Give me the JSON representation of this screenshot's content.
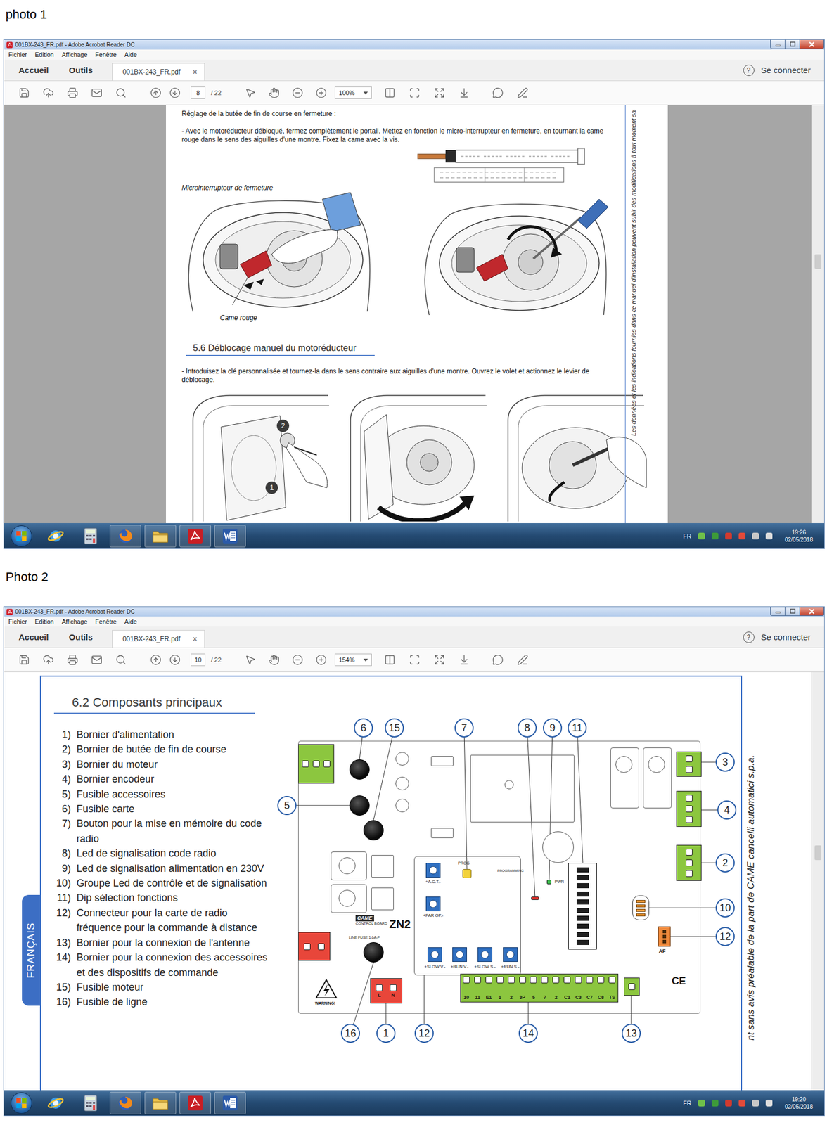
{
  "photos": [
    {
      "label": "photo 1",
      "window": {
        "title": "001BX-243_FR.pdf - Adobe Acrobat Reader DC",
        "menu": [
          "Fichier",
          "Edition",
          "Affichage",
          "Fenêtre",
          "Aide"
        ],
        "nav": [
          {
            "label": "Accueil",
            "selected": false
          },
          {
            "label": "Outils",
            "selected": false
          }
        ],
        "document_tab": {
          "label": "001BX-243_FR.pdf",
          "close": "×",
          "selected": true
        },
        "help": "?",
        "sign_in": "Se connecter",
        "toolbar": {
          "page": "8",
          "page_count": "/ 22",
          "zoom": "100%"
        },
        "scroll_position": 0.37,
        "taskbar": {
          "language": "FR",
          "time": "19:26",
          "date": "02/05/2018",
          "apps": [
            {
              "kind": "browser",
              "open": false
            },
            {
              "kind": "calculator",
              "open": false
            },
            {
              "kind": "firefox",
              "open": true
            },
            {
              "kind": "explorer",
              "open": true
            },
            {
              "kind": "acrobat",
              "open": true
            },
            {
              "kind": "word",
              "open": true
            }
          ]
        }
      },
      "document": {
        "kind": "adjustment",
        "title_line": "Réglage de la butée de fin de course en fermeture :",
        "instruction": "- Avec le motoréducteur débloqué, fermez complètement le portail. Mettez en fonction le micro-interrupteur en fermeture, en tournant la came rouge dans le sens des aiguilles d'une montre. Fixez la came avec la vis.",
        "figure_labels": {
          "switch": "Microinterrupteur de fermeture",
          "cam": "Came rouge"
        },
        "section": "5.6 Déblocage manuel du motoréducteur",
        "section_text": "- Introduisez la clé personnalisée et tournez-la dans le sens contraire aux aiguilles d'une montre. Ouvrez le volet et actionnez le levier de déblocage.",
        "steps": [
          "2",
          "1"
        ],
        "side_note": "Les données et les indications fournies dans ce manuel d'installation peuvent subir des modifications à tout moment sa"
      }
    },
    {
      "label": "Photo 2",
      "window": {
        "title": "001BX-243_FR.pdf - Adobe Acrobat Reader DC",
        "menu": [
          "Fichier",
          "Edition",
          "Affichage",
          "Fenêtre",
          "Aide"
        ],
        "nav": [
          {
            "label": "Accueil",
            "selected": false
          },
          {
            "label": "Outils",
            "selected": false
          }
        ],
        "document_tab": {
          "label": "001BX-243_FR.pdf",
          "close": "×",
          "selected": true
        },
        "help": "?",
        "sign_in": "Se connecter",
        "toolbar": {
          "page": "10",
          "page_count": "/ 22",
          "zoom": "154%"
        },
        "scroll_position": 0.43,
        "taskbar": {
          "language": "FR",
          "time": "19:20",
          "date": "02/05/2018",
          "apps": [
            {
              "kind": "browser",
              "open": false
            },
            {
              "kind": "calculator",
              "open": false
            },
            {
              "kind": "firefox",
              "open": true
            },
            {
              "kind": "explorer",
              "open": true
            },
            {
              "kind": "acrobat",
              "open": true
            },
            {
              "kind": "word",
              "open": true
            }
          ]
        }
      },
      "document": {
        "kind": "components",
        "language_tab": "FRANÇAIS",
        "heading": "6.2 Composants principaux",
        "items": [
          {
            "number": "1)",
            "text": "Bornier d'alimentation"
          },
          {
            "number": "2)",
            "text": "Bornier de butée de fin de course"
          },
          {
            "number": "3)",
            "text": "Bornier du moteur"
          },
          {
            "number": "4)",
            "text": "Bornier encodeur"
          },
          {
            "number": "5)",
            "text": "Fusible accessoires"
          },
          {
            "number": "6)",
            "text": "Fusible carte"
          },
          {
            "number": "7)",
            "text": "Bouton pour la mise en mémoire du code radio"
          },
          {
            "number": "8)",
            "text": "Led de signalisation code radio"
          },
          {
            "number": "9)",
            "text": "Led de signalisation alimentation en 230V"
          },
          {
            "number": "10)",
            "text": "Groupe Led de contrôle et de signalisation"
          },
          {
            "number": "11)",
            "text": "Dip sélection fonctions"
          },
          {
            "number": "12)",
            "text": "Connecteur pour la carte de radio fréquence pour la commande à distance"
          },
          {
            "number": "13)",
            "text": "Bornier pour la connexion de l'antenne"
          },
          {
            "number": "14)",
            "text": "Bornier pour la connexion des accessoires et des dispositifs de commande"
          },
          {
            "number": "15)",
            "text": "Fusible moteur"
          },
          {
            "number": "16)",
            "text": "Fusible de ligne"
          }
        ],
        "side_note": "nt sans avis préalable de la part de CAME cancelli automatici s.p.a.",
        "board": {
          "callouts": [
            "6",
            "15",
            "7",
            "8",
            "9",
            "11",
            "3",
            "4",
            "2",
            "10",
            "12",
            "5",
            "16",
            "1",
            "12",
            "14",
            "13"
          ],
          "brand": "CAME",
          "label": "CONTROL BOARD",
          "model": "ZN2",
          "warning": "WARNING!",
          "prog": "PROG",
          "pwr": "PWR",
          "programming": "PROGRAMMING",
          "af": "AF",
          "ce": "CE",
          "line_fuse": "LINE FUSE 1.6A-F",
          "trimmers_v": [
            "+A.C.T.-",
            "+PAR OP.-"
          ],
          "trimmers_h": [
            "+SLOW V.-",
            "+RUN V.-",
            "+SLOW S.-",
            "+RUN S.-"
          ],
          "terminals": [
            "10",
            "11",
            "E1",
            "1",
            "2",
            "3P",
            "5",
            "7",
            "2",
            "C1",
            "C3",
            "C7",
            "C8",
            "TS"
          ],
          "power_terminal": [
            "L",
            "N"
          ]
        }
      }
    }
  ]
}
